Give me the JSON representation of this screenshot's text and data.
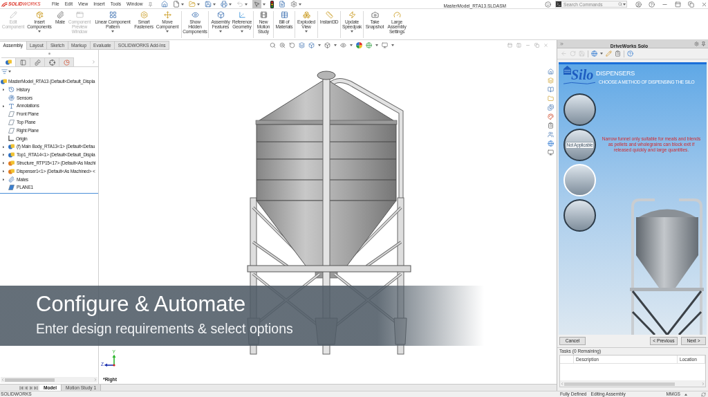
{
  "title_bar": {
    "logo": "**SOLID**WORKS",
    "menus": [
      "File",
      "Edit",
      "View",
      "Insert",
      "Tools",
      "Window"
    ],
    "quick_access": [
      {
        "kind": "home",
        "dropdown": false,
        "pressed": false,
        "disabled": false
      },
      {
        "kind": "new",
        "dropdown": true,
        "pressed": false,
        "disabled": false
      },
      {
        "kind": "open",
        "dropdown": true,
        "pressed": false,
        "disabled": false
      },
      {
        "kind": "save",
        "dropdown": true,
        "pressed": false,
        "disabled": false
      },
      {
        "kind": "print",
        "dropdown": true,
        "pressed": false,
        "disabled": false
      },
      {
        "kind": "undo",
        "dropdown": true,
        "pressed": false,
        "disabled": true
      },
      {
        "kind": "select",
        "dropdown": true,
        "pressed": true,
        "disabled": false
      },
      {
        "kind": "rebuild",
        "dropdown": false,
        "pressed": false,
        "disabled": false
      },
      {
        "kind": "properties",
        "dropdown": false,
        "pressed": false,
        "disabled": false
      },
      {
        "kind": "options",
        "dropdown": true,
        "pressed": false,
        "disabled": false
      }
    ],
    "document_title": "MasterModel_RTA13.SLDASM",
    "search": {
      "placeholder": "Search Commands"
    }
  },
  "ribbon": {
    "groups": [
      [
        {
          "label": "Edit Component",
          "disabled": true,
          "dropdown": false
        },
        {
          "label": "Insert Components",
          "disabled": false,
          "dropdown": true
        },
        {
          "label": "Mate",
          "disabled": false,
          "dropdown": false
        },
        {
          "label": "Component Preview Window",
          "disabled": true,
          "dropdown": false
        },
        {
          "label": "Linear Component Pattern",
          "disabled": false,
          "dropdown": true
        },
        {
          "label": "Smart Fasteners",
          "disabled": false,
          "dropdown": false
        },
        {
          "label": "Move Component",
          "disabled": false,
          "dropdown": true
        }
      ],
      [
        {
          "label": "Show Hidden Components",
          "disabled": false,
          "dropdown": false
        }
      ],
      [
        {
          "label": "Assembly Features",
          "disabled": false,
          "dropdown": true
        },
        {
          "label": "Reference Geometry",
          "disabled": false,
          "dropdown": true
        }
      ],
      [
        {
          "label": "New Motion Study",
          "disabled": false,
          "dropdown": false
        }
      ],
      [
        {
          "label": "Bill of Materials",
          "disabled": false,
          "dropdown": false
        }
      ],
      [
        {
          "label": "Exploded View",
          "disabled": false,
          "dropdown": true
        }
      ],
      [
        {
          "label": "Instant3D",
          "disabled": false,
          "dropdown": false
        }
      ],
      [
        {
          "label": "Update Speedpak",
          "disabled": false,
          "dropdown": true
        }
      ],
      [
        {
          "label": "Take Snapshot",
          "disabled": false,
          "dropdown": false
        },
        {
          "label": "Large Assembly Settings",
          "disabled": false,
          "dropdown": false
        }
      ]
    ]
  },
  "command_tabs": [
    {
      "label": "Assembly",
      "selected": true
    },
    {
      "label": "Layout",
      "selected": false
    },
    {
      "label": "Sketch",
      "selected": false
    },
    {
      "label": "Markup",
      "selected": false
    },
    {
      "label": "Evaluate",
      "selected": false
    },
    {
      "label": "SOLIDWORKS Add-Ins",
      "selected": false
    }
  ],
  "feature_tree": {
    "tabs": [
      {
        "kind": "features",
        "selected": true
      },
      {
        "kind": "properties",
        "selected": false
      },
      {
        "kind": "configurations",
        "selected": false
      },
      {
        "kind": "dimxpert",
        "selected": false
      },
      {
        "kind": "display",
        "selected": false
      }
    ],
    "root": "MasterModel_RTA13 (Default<Default_Displa",
    "items": [
      {
        "label": "History",
        "kind": "history",
        "expandable": true
      },
      {
        "label": "Sensors",
        "kind": "sensors",
        "expandable": false
      },
      {
        "label": "Annotations",
        "kind": "annotations",
        "expandable": true
      },
      {
        "label": "Front Plane",
        "kind": "plane",
        "expandable": false
      },
      {
        "label": "Top Plane",
        "kind": "plane",
        "expandable": false
      },
      {
        "label": "Right Plane",
        "kind": "plane",
        "expandable": false
      },
      {
        "label": "Origin",
        "kind": "origin",
        "expandable": false
      },
      {
        "label": "(f) Main Body_RTA13<1> (Default<Defau",
        "kind": "part",
        "expandable": true
      },
      {
        "label": "Top1_RTA14<1> (Default<Default_Displa",
        "kind": "part",
        "expandable": true
      },
      {
        "label": "Structure_RTP15<17> (Default<As Machi",
        "kind": "subassembly",
        "expandable": true
      },
      {
        "label": "Dispenser1<1> (Default<As Machined> <",
        "kind": "subassembly",
        "expandable": true
      },
      {
        "label": "Mates",
        "kind": "mates",
        "expandable": true
      },
      {
        "label": "PLANE1",
        "kind": "sketch-plane",
        "expandable": false
      }
    ]
  },
  "viewport": {
    "triad": {
      "y_label": "Y",
      "z_label": "Z"
    },
    "view_label": "*Right"
  },
  "banner": {
    "title": "Configure & Automate",
    "subtitle": "Enter design requirements & select options"
  },
  "task_pane": {
    "title": "DriveWorks Solo",
    "toolbar": [
      {
        "kind": "back",
        "disabled": true,
        "dropdown": false
      },
      {
        "kind": "refresh",
        "disabled": true,
        "dropdown": false
      },
      {
        "kind": "save",
        "disabled": true,
        "dropdown": false
      },
      {
        "kind": "specification",
        "disabled": false,
        "dropdown": true
      },
      {
        "kind": "edit",
        "disabled": false,
        "dropdown": false
      },
      {
        "kind": "copy",
        "disabled": false,
        "dropdown": false
      },
      {
        "kind": "help",
        "disabled": false,
        "dropdown": false
      }
    ],
    "form": {
      "logo": "Silo",
      "heading": "DISPENSERS",
      "subheading": "CHOOSE A METHOD OF DISPENSING THE SILO",
      "options": [
        {
          "selected": false
        },
        {
          "selected": false,
          "badge": "Not Applicable"
        },
        {
          "selected": true
        },
        {
          "selected": false
        }
      ],
      "note": "Narrow funnel only suitable for meals and blends as pellets and wholegrains can block exit if released quickly and large quantities."
    },
    "buttons": [
      {
        "label": "Cancel",
        "kind": "cancel"
      },
      {
        "label": "< Previous",
        "kind": "previous"
      },
      {
        "label": "Next >",
        "kind": "next"
      }
    ],
    "tasks": {
      "title": "Tasks (0 Remaining)",
      "columns": [
        "Description",
        "Location"
      ]
    }
  },
  "document_tabs": [
    {
      "label": "Model",
      "selected": true
    },
    {
      "label": "Motion Study 1",
      "selected": false
    }
  ],
  "status_bar": {
    "app": "SOLIDWORKS",
    "items": [
      "Fully Defined",
      "Editing Assembly"
    ],
    "units": "MMGS"
  }
}
